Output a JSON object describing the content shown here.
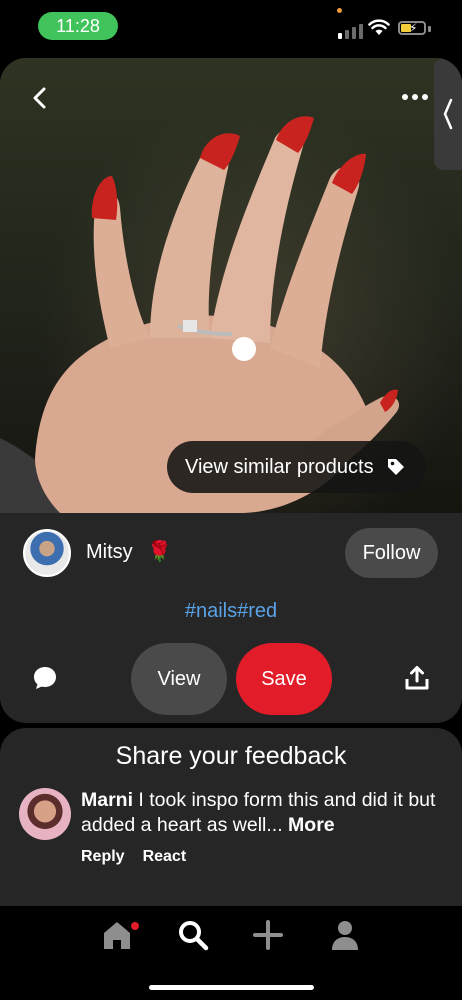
{
  "status_bar": {
    "time": "11:28"
  },
  "pin": {
    "similar_products_label": "View similar products",
    "author": {
      "name": "Mitsy",
      "emoji": "🌹"
    },
    "follow_label": "Follow",
    "hashtags": "#nails#red",
    "view_label": "View",
    "save_label": "Save"
  },
  "feedback": {
    "title": "Share your feedback",
    "comment": {
      "author": "Marni",
      "text": " I took inspo form this and did it but added a heart as well...",
      "more_label": " More",
      "reply_label": "Reply",
      "react_label": "React"
    }
  },
  "colors": {
    "save_red": "#e21c29",
    "follow_gray": "#4a4a4a",
    "hashtag_blue": "#5aa2e6",
    "time_green": "#3fc35a",
    "card_bg": "#262626"
  },
  "icons": {
    "back": "chevron-left-icon",
    "more": "more-horizontal-icon",
    "tag": "tag-icon",
    "comment": "comment-icon",
    "share": "share-icon",
    "home": "home-icon",
    "search": "search-icon",
    "add": "plus-icon",
    "profile": "profile-icon"
  }
}
